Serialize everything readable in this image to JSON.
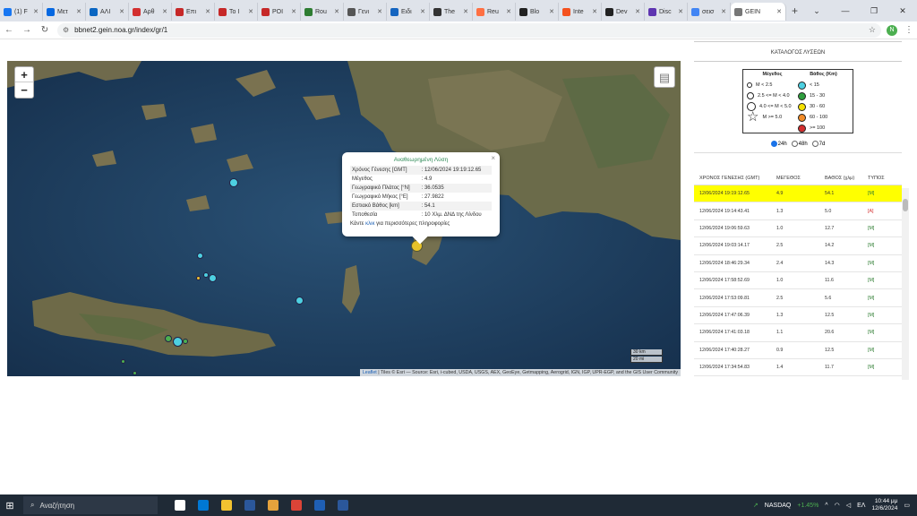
{
  "browser": {
    "tabs": [
      {
        "label": "(1) F",
        "color": "#1877f2"
      },
      {
        "label": "Μετ",
        "color": "#0668e1"
      },
      {
        "label": "ΑΛΙ",
        "color": "#0a66c2"
      },
      {
        "label": "Αρθ",
        "color": "#d32f2f"
      },
      {
        "label": "Επι",
        "color": "#c62828"
      },
      {
        "label": "Το Ι",
        "color": "#c62828"
      },
      {
        "label": "POI",
        "color": "#c62828"
      },
      {
        "label": "Rou",
        "color": "#2e7d32"
      },
      {
        "label": "Γενι",
        "color": "#555555"
      },
      {
        "label": "Ειδι",
        "color": "#1565c0"
      },
      {
        "label": "The",
        "color": "#333333"
      },
      {
        "label": "Reu",
        "color": "#ff7043"
      },
      {
        "label": "Blo",
        "color": "#222222"
      },
      {
        "label": "Inte",
        "color": "#f4511e"
      },
      {
        "label": "Dev",
        "color": "#222222"
      },
      {
        "label": "Disc",
        "color": "#5e35b1"
      },
      {
        "label": "σεισ",
        "color": "#4285f4"
      },
      {
        "label": "GEIN",
        "color": "#777777",
        "active": true
      }
    ],
    "new_tab": "+",
    "url": "bbnet2.gein.noa.gr/index/gr/1",
    "profile_initial": "N"
  },
  "map": {
    "zoom_in": "+",
    "zoom_out": "−",
    "popup": {
      "title": "Αναθεωρημένη Λύση",
      "rows": [
        {
          "label": "Χρόνος Γένεσης [GMT]",
          "value": ": 12/06/2024 19:19:12.65"
        },
        {
          "label": "Μέγεθος",
          "value": ": 4.9"
        },
        {
          "label": "Γεωγραφικό Πλάτος [°N]",
          "value": ": 36.0535"
        },
        {
          "label": "Γεωγραφικό Μήκος [°E]",
          "value": ": 27.9822"
        },
        {
          "label": "Εστιακό Βάθος [km]",
          "value": ": 54.1"
        },
        {
          "label": "Τοποθεσία",
          "value": ": 10 Χλμ. ΔΝΔ της Λίνδου"
        }
      ],
      "more_prefix": "Κάντε ",
      "more_link": "κλικ",
      "more_suffix": " για περισσότερες πληροφορίες",
      "close": "×"
    },
    "scale_km": "30 km",
    "scale_mi": "20 mi",
    "attribution_link": "Leaflet",
    "attribution": " | Tiles © Esri — Source: Esri, i-cubed, USDA, USGS, AEX, GeoEye, Getmapping, Aerogrid, IGN, IGP, UPR-EGP, and the GIS User Community",
    "colors": {
      "shallow": "#4dd0e1",
      "mid": "#4caf50",
      "deep": "#f2c230",
      "selected": "#e6c22a"
    }
  },
  "sidebar": {
    "title": "ΚΑΤΑΛΟΓΟΣ ΛΥΣΕΩΝ",
    "legend": {
      "mag_title": "Μέγεθος",
      "mag_items": [
        "M < 2.5",
        "2.5 <= M < 4.0",
        "4.0 <= M < 5.0",
        "M >= 5.0"
      ],
      "depth_title": "Βάθος (Km)",
      "depth_items": [
        {
          "label": "< 15",
          "color": "#4dd0e1"
        },
        {
          "label": "15 - 30",
          "color": "#2e9e3e"
        },
        {
          "label": "30 - 60",
          "color": "#f5e000"
        },
        {
          "label": "60 - 100",
          "color": "#f28c28"
        },
        {
          "label": ">= 100",
          "color": "#d32f2f"
        }
      ]
    },
    "periods": [
      {
        "label": "24h",
        "checked": true
      },
      {
        "label": "48h",
        "checked": false
      },
      {
        "label": "7d",
        "checked": false
      }
    ],
    "columns": [
      "ΧΡΟΝΟΣ ΓΕΝΕΣΗΣ (GMT)",
      "ΜΕΓΕΘΟΣ",
      "ΒΑΘΟΣ (χλμ)",
      "ΤΥΠΟΣ"
    ],
    "rows": [
      {
        "time": "12/06/2024 19:19:12.65",
        "mag": "4.9",
        "depth": "54.1",
        "type": "[M]",
        "highlight": true
      },
      {
        "time": "12/06/2024 19:14:43.41",
        "mag": "1.3",
        "depth": "5.0",
        "type": "[A]"
      },
      {
        "time": "12/06/2024 19:06:59.63",
        "mag": "1.0",
        "depth": "12.7",
        "type": "[M]"
      },
      {
        "time": "12/06/2024 19:03:14.17",
        "mag": "2.5",
        "depth": "14.2",
        "type": "[M]"
      },
      {
        "time": "12/06/2024 18:46:29.34",
        "mag": "2.4",
        "depth": "14.3",
        "type": "[M]"
      },
      {
        "time": "12/06/2024 17:58:52.69",
        "mag": "1.0",
        "depth": "11.6",
        "type": "[M]"
      },
      {
        "time": "12/06/2024 17:53:09.81",
        "mag": "2.5",
        "depth": "5.6",
        "type": "[M]"
      },
      {
        "time": "12/06/2024 17:47:06.39",
        "mag": "1.3",
        "depth": "12.5",
        "type": "[M]"
      },
      {
        "time": "12/06/2024 17:41:03.18",
        "mag": "1.1",
        "depth": "20.6",
        "type": "[M]"
      },
      {
        "time": "12/06/2024 17:40:28.27",
        "mag": "0.9",
        "depth": "12.5",
        "type": "[M]"
      },
      {
        "time": "12/06/2024 17:34:54.83",
        "mag": "1.4",
        "depth": "11.7",
        "type": "[M]"
      }
    ]
  },
  "taskbar": {
    "search_placeholder": "Αναζήτηση",
    "ticker_name": "NASDAQ",
    "ticker_change": "+1.45%",
    "lang": "ΕΛ",
    "time": "10:44 μμ",
    "date": "12/6/2024",
    "app_colors": [
      "#ffffff",
      "#0078d4",
      "#f2c230",
      "#2b579a",
      "#e6a23c",
      "#db4437",
      "#1f5fb4",
      "#2b579a"
    ]
  }
}
